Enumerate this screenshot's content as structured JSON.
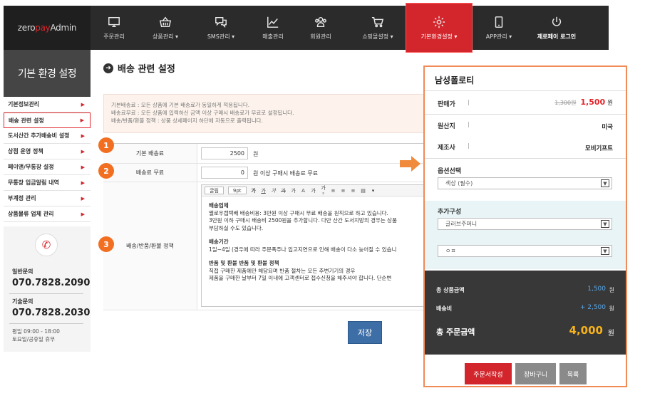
{
  "logo": {
    "part1": "zero",
    "part2": "pay",
    "part3": " Admin"
  },
  "nav": [
    {
      "label": "주문관리",
      "icon": "monitor-icon"
    },
    {
      "label": "상품관리 ▾",
      "icon": "basket-icon"
    },
    {
      "label": "SMS관리 ▾",
      "icon": "chat-icon"
    },
    {
      "label": "매출관리",
      "icon": "line-chart-icon"
    },
    {
      "label": "회원관리",
      "icon": "users-icon"
    },
    {
      "label": "쇼핑몰설정 ▾",
      "icon": "cart-icon"
    },
    {
      "label": "기본환경설정 ▾",
      "icon": "gear-icon"
    },
    {
      "label": "APP관리 ▾",
      "icon": "phone-icon"
    },
    {
      "label": "제로페이 로그인",
      "icon": "power-icon"
    }
  ],
  "sidebar": {
    "heading": "기본 환경 설정",
    "items": [
      "기본정보관리",
      "배송 관련 설정",
      "도서산간 추가배송비 설정",
      "상점 운영 정책",
      "페이앤/무통장 설정",
      "무통장 입금알림 내역",
      "부계정 관리",
      "상품물류 업체 관리"
    ],
    "contact": {
      "general_label": "일반문의",
      "general_phone": "070.7828.2090",
      "tech_label": "기술문의",
      "tech_phone": "070.7828.2030",
      "hours1": "평일 09:00 - 18:00",
      "hours2": "토요일/공휴일 휴무"
    }
  },
  "main": {
    "title": "배송 관련 설정",
    "notice": [
      "기본배송료 : 모든 상품에 기본 배송료가 동일하게 적용됩니다.",
      "배송료무료 : 모든 상품에 입력하신 금액 이상 구매시 배송료가 무료로 설정됩니다.",
      "배송/반품/환불 정책 : 상품 상세페이지 하단에 자동으로 출력됩니다."
    ],
    "rows": {
      "base_fee_label": "기본 배송료",
      "base_fee_value": "2500",
      "base_fee_unit": "원",
      "free_label": "배송료 무료",
      "free_value": "0",
      "free_unit": "원 이상 구매시 배송료 무료",
      "policy_label": "배송/반품/환불 정책"
    },
    "badges": [
      "1",
      "2",
      "3"
    ],
    "editor": {
      "font_select": "굴림",
      "size_select": "9pt",
      "tools": [
        "가",
        "가",
        "가",
        "가",
        "가",
        "A",
        "가",
        "가²"
      ],
      "content": [
        {
          "text": "배송업체",
          "bold": true
        },
        {
          "text": "옐로우캡택배 배송비용: 3만원 이상 구매시 무료 배송을 원칙으로 하고 있습니다.",
          "bold": false
        },
        {
          "text": "3만원 이하 구매시 배송비 2500원을 추가합니다. 다만 산간 도서지방의 경우는 상품",
          "bold": false
        },
        {
          "text": "부담하실 수도 있습니다.",
          "bold": false
        },
        {
          "text": "",
          "bold": false
        },
        {
          "text": "배송기간",
          "bold": true
        },
        {
          "text": "1일~4일 (경우에 따라 주문폭주나 입고지연으로 인해 배송이 다소 늦어질 수 있습니",
          "bold": false
        },
        {
          "text": "",
          "bold": false
        },
        {
          "text": "반품 및 환불 반품 및 환불 정책",
          "bold": true
        },
        {
          "text": "직접 구매한 제품에만 해당되며 반품 절차는 모든 주변기기의 경우",
          "bold": false
        },
        {
          "text": "제품을 구매한 날부터 7일 이내에 고객센터로 접수신청을 해주셔야 합니다. 단순변",
          "bold": false
        }
      ]
    },
    "save_label": "저장"
  },
  "product": {
    "name": "남성폴로티",
    "price_label": "판매가",
    "original_price": "1,300원",
    "sale_price": "1,500",
    "price_unit": "원",
    "origin_label": "원산지",
    "origin_value": "미국",
    "maker_label": "제조사",
    "maker_value": "모비기프트",
    "option_label": "옵션선택",
    "option_value": "색상 (필수)",
    "addon_label": "추가구성",
    "addon_value1": "글러브주머니",
    "addon_value2": "ㅇㅍ",
    "summary": {
      "goods_label": "총 상품금액",
      "goods_value": "1,500",
      "ship_label": "배송비",
      "ship_value": "+ 2,500",
      "won": "원",
      "total_label": "총 주문금액",
      "total_value": "4,000",
      "total_won": "원"
    },
    "buttons": {
      "order": "주문서작성",
      "cart": "장바구니",
      "list": "목록"
    }
  },
  "colors": {
    "accent_red": "#d3262c",
    "badge_orange": "#f26f21",
    "save_blue": "#3e6ea6",
    "total_gold": "#f6b21b"
  }
}
